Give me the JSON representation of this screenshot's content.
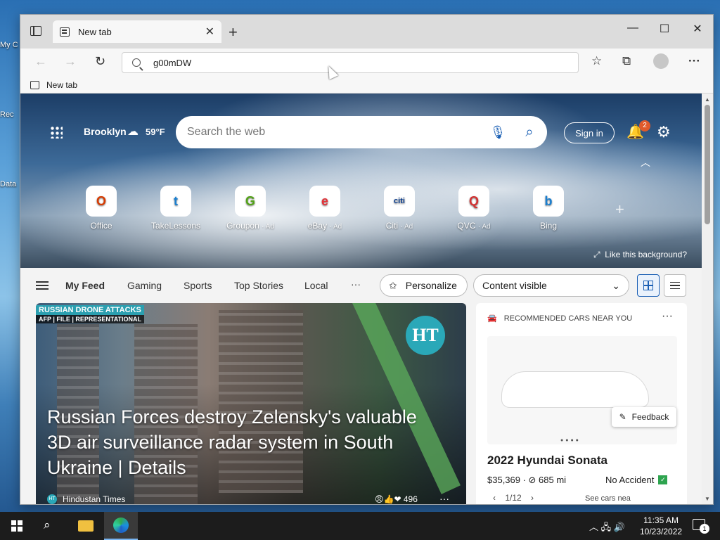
{
  "desktop": {
    "icons": [
      {
        "label": "My C"
      },
      {
        "label": "Rec"
      },
      {
        "label": "Data"
      }
    ]
  },
  "browser": {
    "tab_title": "New tab",
    "address_value": "g00mDW",
    "favorites_bar_item": "New tab"
  },
  "newtab": {
    "weather": {
      "city": "Brooklyn",
      "temp": "59°F"
    },
    "search_placeholder": "Search the web",
    "signin_label": "Sign in",
    "notification_count": "2",
    "quick_links": [
      {
        "label": "Office",
        "ad": "",
        "glyph": "O",
        "color": "#d83b01"
      },
      {
        "label": "TakeLessons",
        "ad": "",
        "glyph": "t",
        "color": "#1a7fd0"
      },
      {
        "label": "Groupon",
        "ad": "· Ad",
        "glyph": "G",
        "color": "#53a318"
      },
      {
        "label": "eBay",
        "ad": "· Ad",
        "glyph": "e",
        "color": "#e53238"
      },
      {
        "label": "Citi",
        "ad": "· Ad",
        "glyph": "citi",
        "color": "#0a3d8f"
      },
      {
        "label": "QVC",
        "ad": "· Ad",
        "glyph": "Q",
        "color": "#d43232"
      },
      {
        "label": "Bing",
        "ad": "",
        "glyph": "b",
        "color": "#1a7fd0"
      }
    ],
    "like_background": "Like this background?"
  },
  "feed_nav": {
    "tabs": [
      "My Feed",
      "Gaming",
      "Sports",
      "Top Stories",
      "Local"
    ],
    "more": "···",
    "personalize_label": "Personalize",
    "content_visible_label": "Content visible"
  },
  "article": {
    "tag": "RUSSIAN DRONE ATTACKS",
    "credit": "AFP | FILE | REPRESENTATIONAL",
    "logo_text": "HT",
    "headline": "Russian Forces destroy Zelensky's valuable 3D air surveillance radar system in South Ukraine | Details",
    "source": "Hindustan Times",
    "source_badge": "HT",
    "reaction_count": "496"
  },
  "car_card": {
    "header": "RECOMMENDED CARS NEAR YOU",
    "title": "2022 Hyundai Sonata",
    "price_miles": "$35,369 · ⊘ 685 mi",
    "accident": "No Accident",
    "pager": "1/12",
    "see_cars": "See cars nea"
  },
  "feedback_label": "Feedback",
  "taskbar": {
    "time": "11:35 AM",
    "date": "10/23/2022",
    "notifications": "1"
  }
}
